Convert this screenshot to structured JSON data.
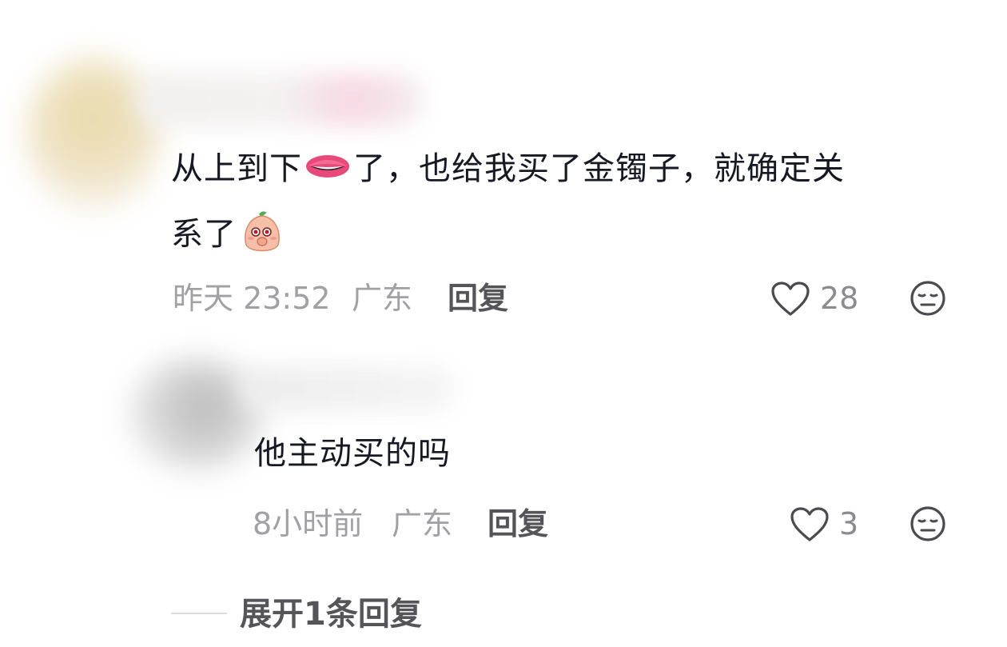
{
  "comment": {
    "text_line1_a": "从上到下",
    "text_line1_b": "了，也给我买了金镯子，就确定关",
    "text_line2": "系了",
    "emoji_1": "lips-emoji",
    "emoji_2": "shy-peach-emoji",
    "time": "昨天 23:52",
    "location": "广东",
    "reply_label": "回复",
    "like_count": "28"
  },
  "reply": {
    "text": "他主动买的吗",
    "time": "8小时前",
    "location": "广东",
    "reply_label": "回复",
    "like_count": "3"
  },
  "expand": {
    "label": "展开1条回复"
  },
  "colors": {
    "primary_text": "#161823",
    "meta_text": "#a0a0a5",
    "action_text": "#555559",
    "icon_stroke": "#4a4a4f"
  }
}
